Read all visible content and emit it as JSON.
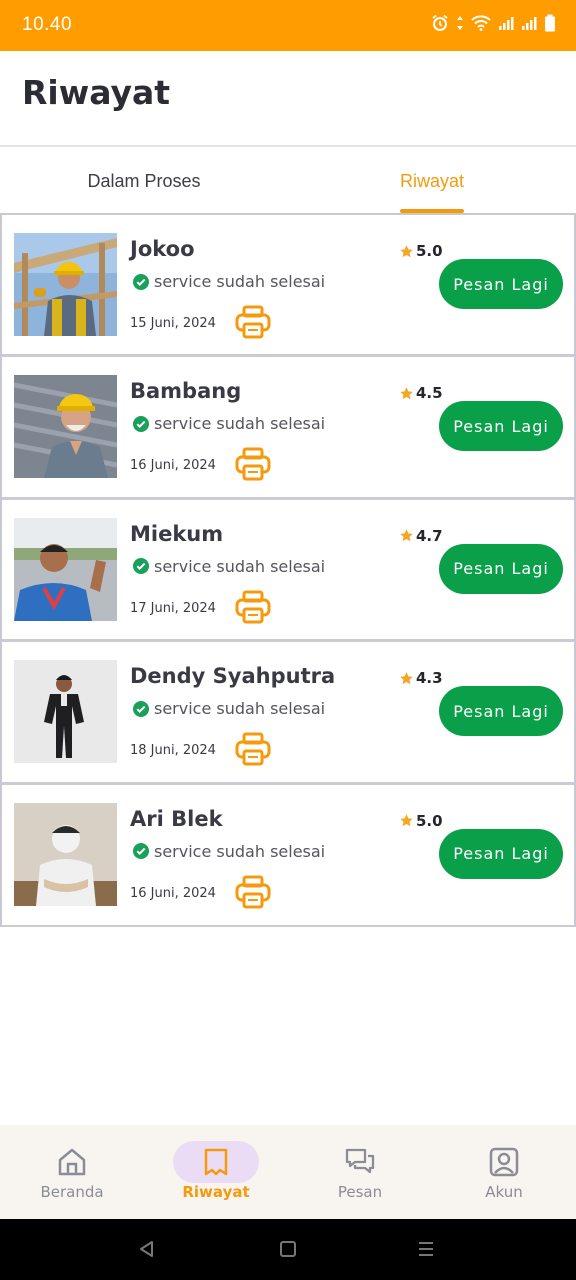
{
  "status_bar": {
    "time": "10.40"
  },
  "header": {
    "title": "Riwayat"
  },
  "tabs": [
    {
      "label": "Dalam Proses"
    },
    {
      "label": "Riwayat"
    }
  ],
  "orders": [
    {
      "name": "Jokoo",
      "status": "service sudah selesai",
      "date": "15 Juni, 2024",
      "rating": "5.0",
      "button": "Pesan Lagi"
    },
    {
      "name": "Bambang",
      "status": "service sudah selesai",
      "date": "16 Juni, 2024",
      "rating": "4.5",
      "button": "Pesan Lagi"
    },
    {
      "name": "Miekum",
      "status": "service sudah selesai",
      "date": "17 Juni, 2024",
      "rating": "4.7",
      "button": "Pesan Lagi"
    },
    {
      "name": "Dendy Syahputra",
      "status": "service sudah selesai",
      "date": "18 Juni, 2024",
      "rating": "4.3",
      "button": "Pesan Lagi"
    },
    {
      "name": "Ari Blek",
      "status": "service sudah selesai",
      "date": "16 Juni, 2024",
      "rating": "5.0",
      "button": "Pesan Lagi"
    }
  ],
  "bottom_nav": [
    {
      "label": "Beranda",
      "icon": "home-icon"
    },
    {
      "label": "Riwayat",
      "icon": "receipt-icon"
    },
    {
      "label": "Pesan",
      "icon": "chat-icon"
    },
    {
      "label": "Akun",
      "icon": "account-icon"
    }
  ],
  "colors": {
    "accent": "#ff9c00",
    "tab_active": "#f59a0d",
    "button_green": "#0aa04a",
    "check_green": "#1aa05a",
    "star": "#f5a623",
    "nav_active_pill": "#eadcf5"
  }
}
